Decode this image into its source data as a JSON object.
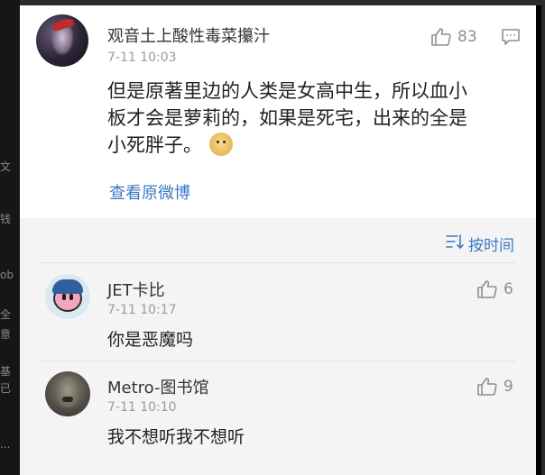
{
  "side_fragments": [
    "文",
    "钱",
    "ob",
    "全",
    "意",
    "基",
    "已",
    "..."
  ],
  "main_comment": {
    "username": "观音土上酸性毒菜攥汁",
    "timestamp": "7-11 10:03",
    "like_count": "83",
    "text_line1": "但是原著里边的人类是女高中生，所以血小",
    "text_line2": "板才会是萝莉的，如果是死宅，出来的全是",
    "text_line3": "小死胖子。",
    "view_original_label": "查看原微博"
  },
  "sort_label": "按时间",
  "replies": [
    {
      "username": "JET卡比",
      "timestamp": "7-11 10:17",
      "text": "你是恶魔吗",
      "like_count": "6"
    },
    {
      "username": "Metro-图书馆",
      "timestamp": "7-11 10:10",
      "text": "我不想听我不想听",
      "like_count": "9"
    }
  ],
  "icons": {
    "like": "thumbs-up-icon",
    "comment": "comment-icon",
    "sort": "sort-icon",
    "emoji": "doge-emoji-icon"
  },
  "colors": {
    "link": "#3b7ac4",
    "text": "#222222",
    "meta": "#9b9b9b"
  }
}
